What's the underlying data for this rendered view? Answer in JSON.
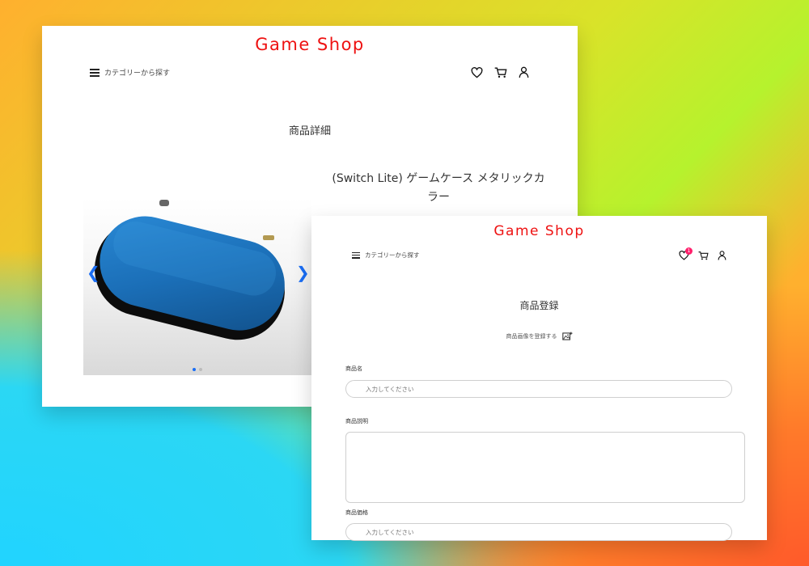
{
  "detail_page": {
    "shop_title": "Game Shop",
    "nav": {
      "category_label": "カテゴリーから探す"
    },
    "page_title": "商品詳細",
    "product": {
      "name_line1": "(Switch Lite) ゲームケース メタリックカ",
      "name_line2": "ラー"
    },
    "carousel": {
      "slide_count": 2,
      "active_slide": 1
    }
  },
  "register_page": {
    "shop_title": "Game Shop",
    "nav": {
      "category_label": "カテゴリーから探す"
    },
    "favorites_badge": "1",
    "page_title": "商品登録",
    "image_register_label": "商品画像を登録する",
    "fields": {
      "name": {
        "label": "商品名",
        "placeholder": "入力してください"
      },
      "description": {
        "label": "商品説明"
      },
      "price": {
        "label": "商品価格",
        "placeholder": "入力してください"
      }
    }
  },
  "colors": {
    "brand": "#ee1111",
    "accent": "#1a6ef5",
    "badge": "#ff1f6b",
    "case": "#1f78c2"
  },
  "icons": [
    "menu-icon",
    "heart-icon",
    "cart-icon",
    "user-icon",
    "chevron-left-icon",
    "chevron-right-icon",
    "add-image-icon"
  ]
}
